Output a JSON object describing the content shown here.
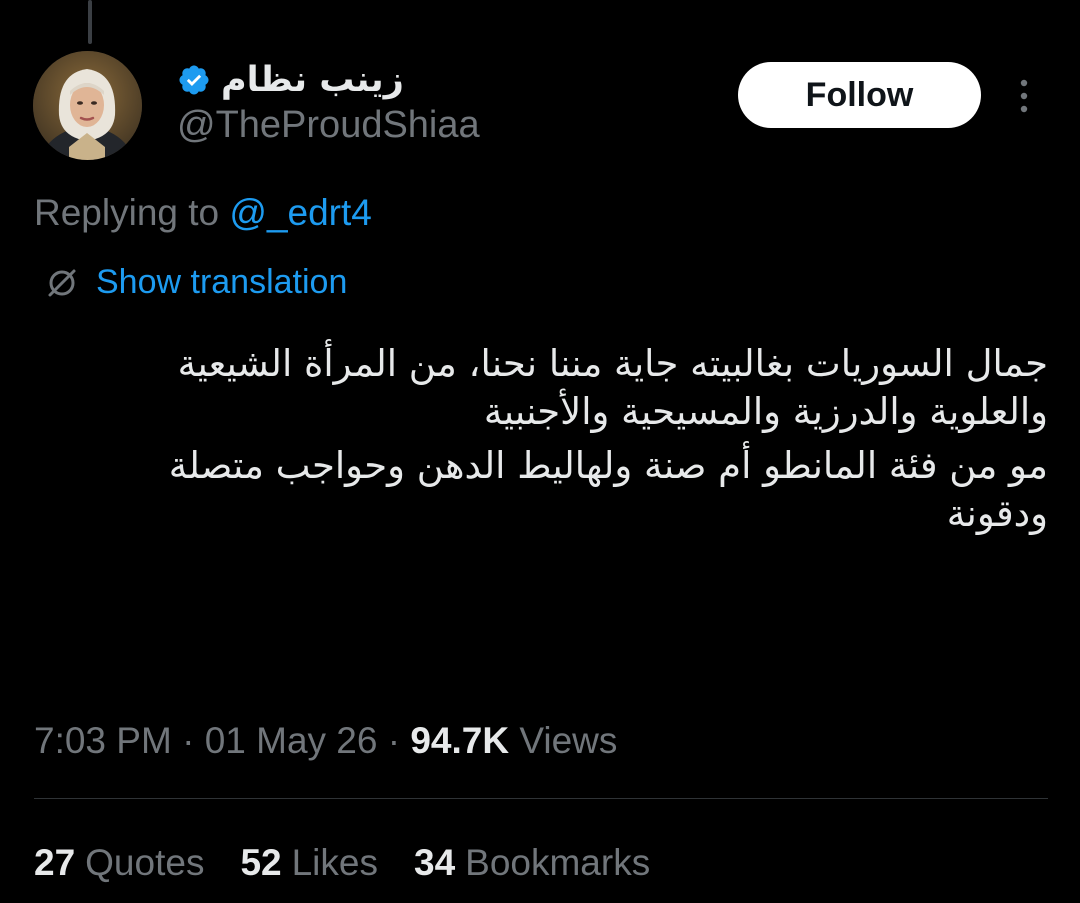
{
  "author": {
    "display_name": "زينب نظام",
    "handle": "@TheProudShiaa",
    "verified_color": "#1d9bf0"
  },
  "follow_label": "Follow",
  "reply": {
    "prefix": "Replying to ",
    "mention": "@_edrt4"
  },
  "translation_label": "Show translation",
  "tweet": {
    "paragraphs": [
      "جمال السوريات بغالبيته جاية مننا نحنا، من المرأة الشيعية\nوالعلوية والدرزية والمسيحية والأجنبية",
      "مو من فئة المانطو أم صنة ولهاليط الدهن وحواجب متصلة\nودقونة"
    ]
  },
  "meta": {
    "time": "7:03 PM",
    "separator": "·",
    "date": "01 May 26",
    "views_count": "94.7K",
    "views_label": "Views"
  },
  "stats": [
    {
      "count": "27",
      "label": "Quotes"
    },
    {
      "count": "52",
      "label": "Likes"
    },
    {
      "count": "34",
      "label": "Bookmarks"
    }
  ],
  "icons": {
    "more": "more-vertical-icon",
    "translate": "globe-icon",
    "verified": "verified-badge-icon"
  }
}
